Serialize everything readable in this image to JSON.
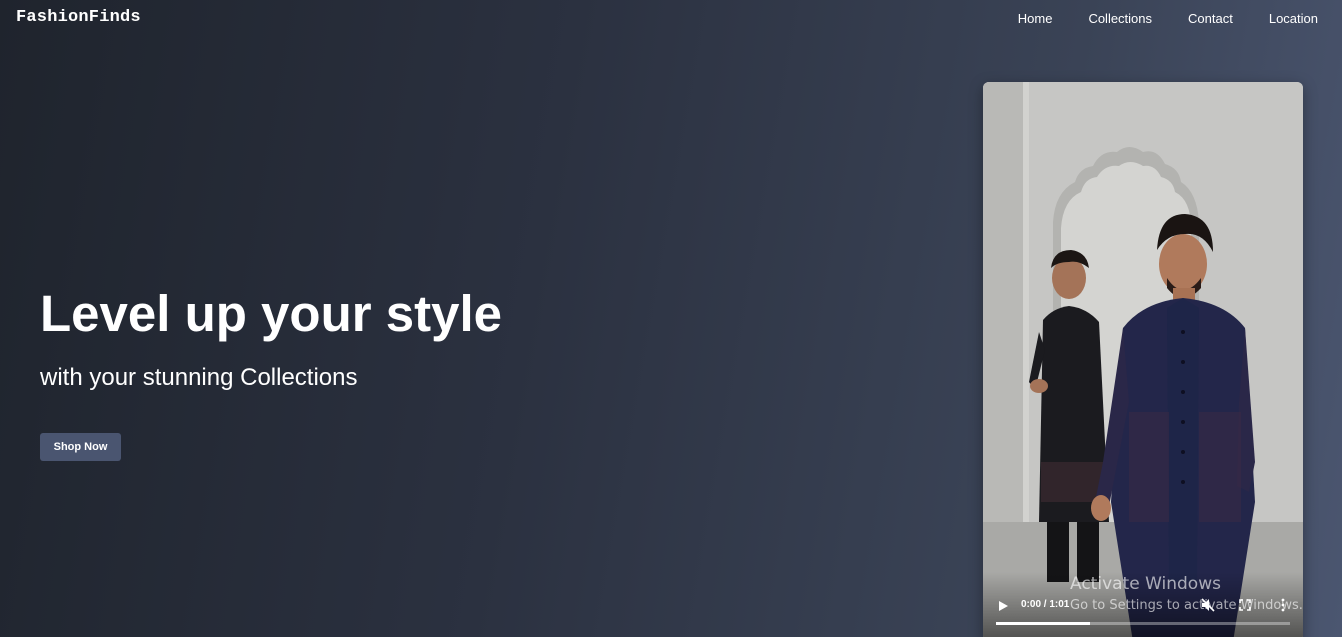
{
  "brand": "FashionFinds",
  "nav": {
    "items": [
      {
        "label": "Home"
      },
      {
        "label": "Collections"
      },
      {
        "label": "Contact"
      },
      {
        "label": "Location"
      }
    ]
  },
  "hero": {
    "title": "Level up your style",
    "subtitle": "with your stunning Collections",
    "cta_label": "Shop Now"
  },
  "video": {
    "time_display": "0:00 / 1:01",
    "progress_fraction": 0.32,
    "controls": [
      "play-icon",
      "mute-icon",
      "fullscreen-icon",
      "more-options-icon"
    ]
  },
  "watermark": {
    "title": "Activate Windows",
    "subtitle": "Go to Settings to activate Windows."
  },
  "colors": {
    "button_bg": "#4a5570",
    "outfit_navy": "#1e2548",
    "outfit_black": "#1a1a1e",
    "backdrop_gray": "#c9c9c9"
  }
}
